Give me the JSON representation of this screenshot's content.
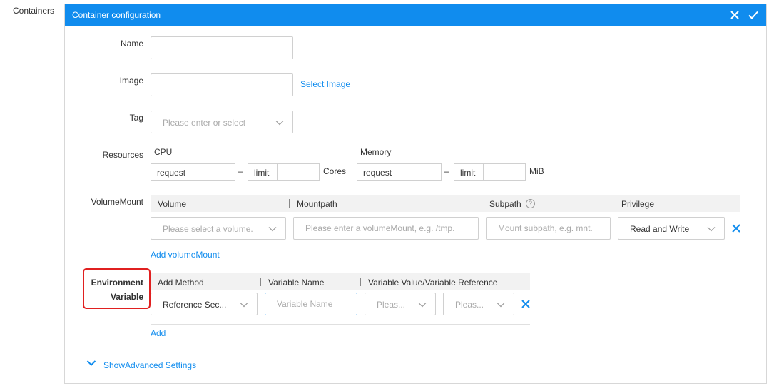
{
  "section_label": "Containers",
  "panel": {
    "title": "Container configuration",
    "close_icon": "close-icon",
    "confirm_icon": "check-icon"
  },
  "name": {
    "label": "Name",
    "value": ""
  },
  "image": {
    "label": "Image",
    "value": "",
    "select_link": "Select Image"
  },
  "tag": {
    "label": "Tag",
    "placeholder": "Please enter or select"
  },
  "resources": {
    "label": "Resources",
    "cpu": {
      "title": "CPU",
      "request_label": "request",
      "limit_label": "limit",
      "unit": "Cores",
      "dash": "–"
    },
    "memory": {
      "title": "Memory",
      "request_label": "request",
      "limit_label": "limit",
      "unit": "MiB",
      "dash": "–"
    }
  },
  "volume_mount": {
    "label": "VolumeMount",
    "columns": [
      "Volume",
      "Mountpath",
      "Subpath",
      "Privilege"
    ],
    "help_glyph": "?",
    "row": {
      "volume_placeholder": "Please select a volume.",
      "mountpath_placeholder": "Please enter a volumeMount, e.g. /tmp.",
      "subpath_placeholder": "Mount subpath, e.g. mnt.",
      "privilege_value": "Read and Write"
    },
    "add_link": "Add volumeMount"
  },
  "env": {
    "label_line1": "Environment",
    "label_line2": "Variable",
    "columns": [
      "Add Method",
      "Variable Name",
      "Variable Value/Variable Reference"
    ],
    "row": {
      "method_value": "Reference Sec...",
      "name_placeholder": "Variable Name",
      "value1_placeholder": "Pleas...",
      "value2_placeholder": "Pleas..."
    },
    "add_link": "Add"
  },
  "advanced": {
    "label": "ShowAdvanced Settings"
  },
  "colors": {
    "accent": "#108cee",
    "highlight": "#e02020"
  }
}
